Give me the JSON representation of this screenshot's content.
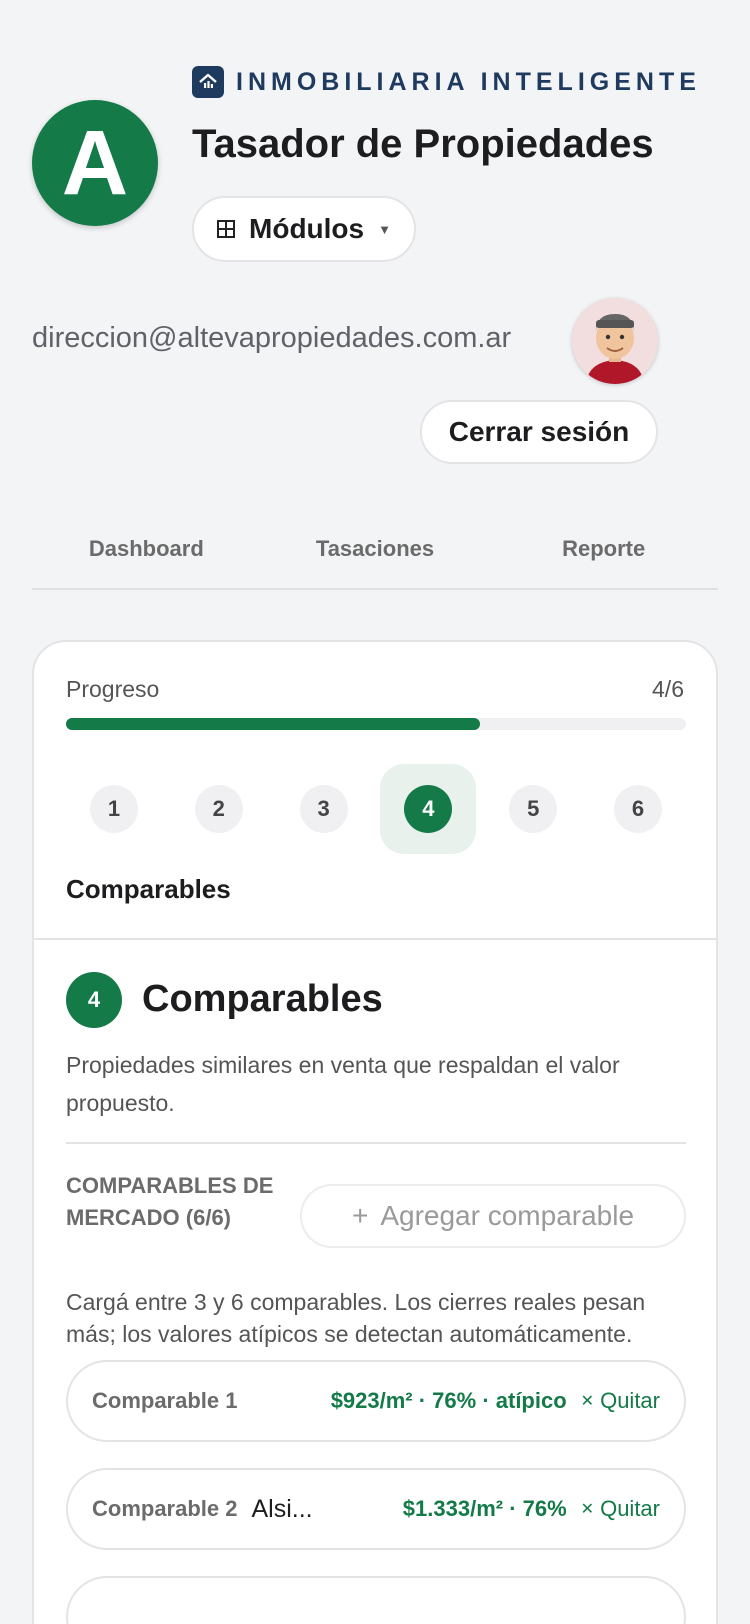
{
  "brand": {
    "name": "INMOBILIARIA INTELIGENTE",
    "icon": "house-chart-icon",
    "logo_letter": "A"
  },
  "header": {
    "title": "Tasador de Propiedades",
    "modules_label": "Módulos",
    "email": "direccion@altevapropiedades.com.ar",
    "logout_label": "Cerrar sesión"
  },
  "tabs": [
    {
      "label": "Dashboard"
    },
    {
      "label": "Tasaciones"
    },
    {
      "label": "Reporte"
    }
  ],
  "progress": {
    "label": "Progreso",
    "count": "4/6",
    "fraction": 0.667,
    "steps": [
      "1",
      "2",
      "3",
      "4",
      "5",
      "6"
    ],
    "active_step": 4,
    "current_step_name": "Comparables"
  },
  "section": {
    "number": "4",
    "title": "Comparables",
    "description": "Propiedades similares en venta que respaldan el valor propuesto.",
    "market_title": "COMPARABLES DE MERCADO (6/6)",
    "add_label": "Agregar comparable",
    "hint": "Cargá entre 3 y 6 comparables. Los cierres reales pesan más; los valores atípicos se detectan automáticamente."
  },
  "comparables": [
    {
      "name": "Comparable 1",
      "extra": "",
      "price": "$923/m² · 76% · atípico",
      "remove": "Quitar"
    },
    {
      "name": "Comparable 2",
      "extra": "Alsi...",
      "price": "$1.333/m² · 76%",
      "remove": "Quitar"
    }
  ],
  "colors": {
    "accent": "#137a48",
    "brand": "#1f3a5f",
    "background": "#f3f4f6"
  }
}
